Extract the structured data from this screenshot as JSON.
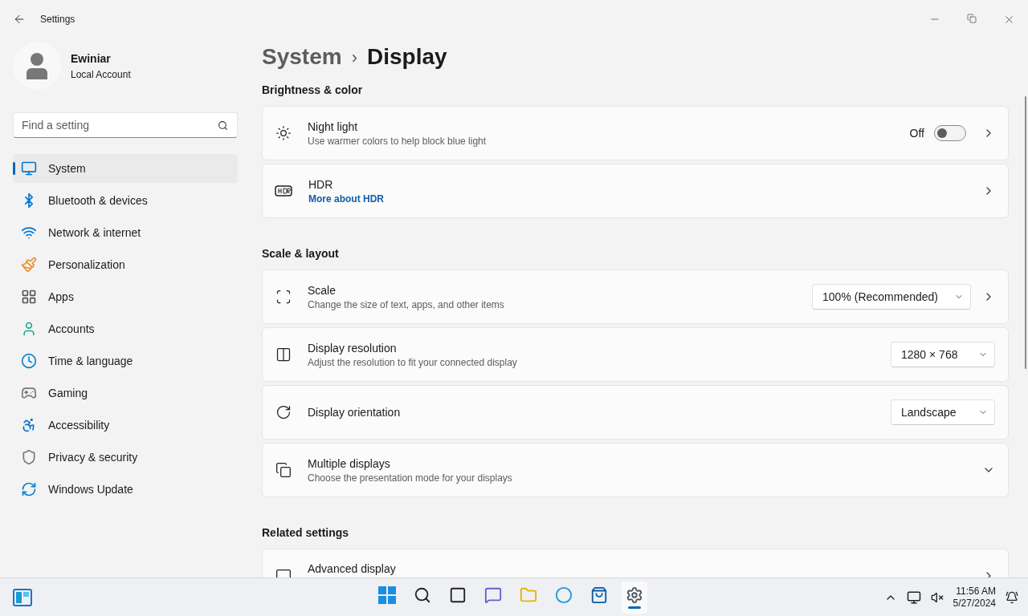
{
  "window": {
    "title": "Settings"
  },
  "user": {
    "name": "Ewiniar",
    "account": "Local Account"
  },
  "search": {
    "placeholder": "Find a setting"
  },
  "nav": [
    {
      "label": "System",
      "selected": true
    },
    {
      "label": "Bluetooth & devices",
      "selected": false
    },
    {
      "label": "Network & internet",
      "selected": false
    },
    {
      "label": "Personalization",
      "selected": false
    },
    {
      "label": "Apps",
      "selected": false
    },
    {
      "label": "Accounts",
      "selected": false
    },
    {
      "label": "Time & language",
      "selected": false
    },
    {
      "label": "Gaming",
      "selected": false
    },
    {
      "label": "Accessibility",
      "selected": false
    },
    {
      "label": "Privacy & security",
      "selected": false
    },
    {
      "label": "Windows Update",
      "selected": false
    }
  ],
  "breadcrumb": {
    "parent": "System",
    "separator": "›",
    "current": "Display"
  },
  "sections": [
    {
      "title": "Brightness & color",
      "rows": [
        {
          "kind": "toggle",
          "title": "Night light",
          "subtitle": "Use warmer colors to help block blue light",
          "state_label": "Off",
          "on": false
        },
        {
          "kind": "link",
          "title": "HDR",
          "link": "More about HDR"
        }
      ]
    },
    {
      "title": "Scale & layout",
      "rows": [
        {
          "kind": "dropdown",
          "title": "Scale",
          "subtitle": "Change the size of text, apps, and other items",
          "value": "100% (Recommended)",
          "chevron": true
        },
        {
          "kind": "dropdown",
          "title": "Display resolution",
          "subtitle": "Adjust the resolution to fit your connected display",
          "value": "1280 × 768",
          "chevron": false
        },
        {
          "kind": "dropdown",
          "title": "Display orientation",
          "value": "Landscape",
          "chevron": false
        },
        {
          "kind": "expand",
          "title": "Multiple displays",
          "subtitle": "Choose the presentation mode for your displays",
          "expanded": false
        }
      ]
    },
    {
      "title": "Related settings",
      "rows": [
        {
          "kind": "link",
          "title": "Advanced display"
        }
      ]
    }
  ],
  "taskbar": {
    "apps": [
      {
        "selected": false
      },
      {
        "selected": false
      },
      {
        "selected": false
      },
      {
        "selected": false
      },
      {
        "selected": false
      },
      {
        "selected": false
      },
      {
        "selected": false
      },
      {
        "selected": true
      }
    ],
    "time": "11:56 AM",
    "date": "5/27/2024"
  }
}
